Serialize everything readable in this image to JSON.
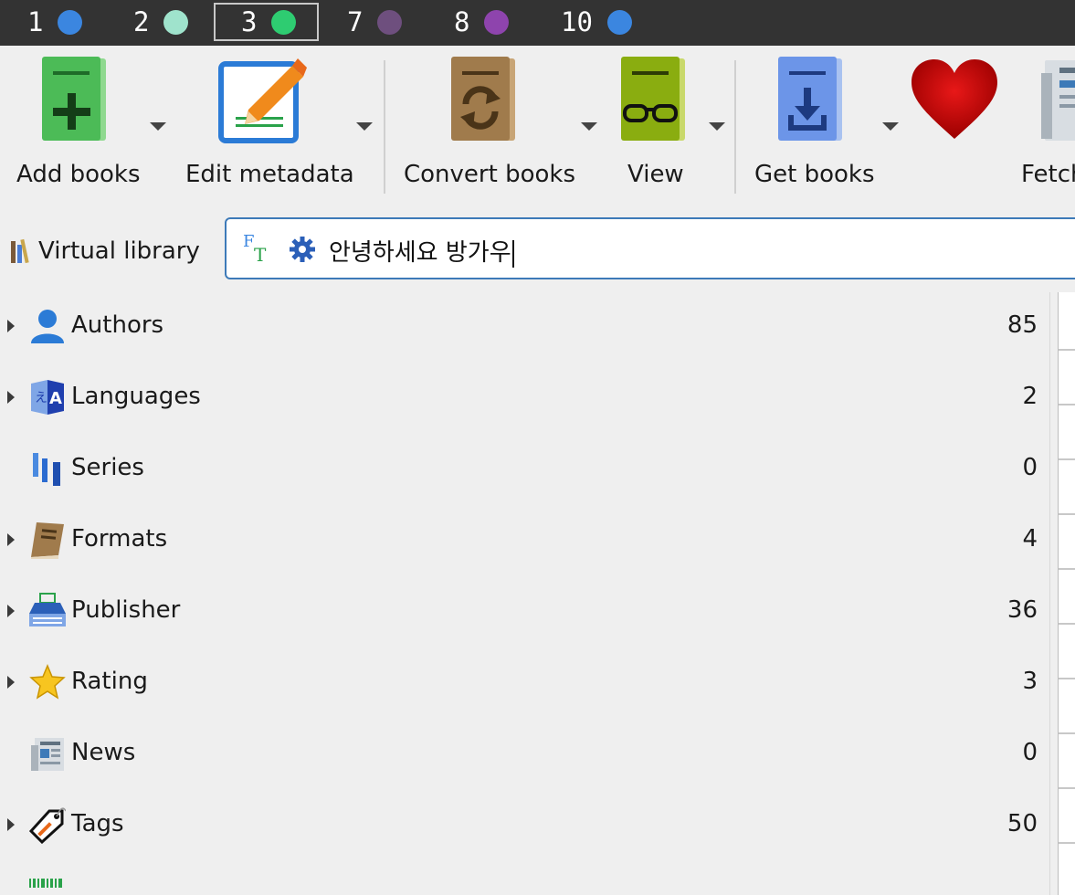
{
  "workspaces": [
    {
      "num": "1",
      "color": "#3b86e0",
      "active": false
    },
    {
      "num": "2",
      "color": "#9fe3cc",
      "active": false
    },
    {
      "num": "3",
      "color": "#2ecc71",
      "active": true
    },
    {
      "num": "7",
      "color": "#6e4f7e",
      "active": false
    },
    {
      "num": "8",
      "color": "#8e44ad",
      "active": false
    },
    {
      "num": "10",
      "color": "#3b86e0",
      "active": false
    }
  ],
  "toolbar": {
    "add_books": "Add books",
    "edit_metadata": "Edit metadata",
    "convert_books": "Convert books",
    "view": "View",
    "get_books": "Get books",
    "fetch_news": "Fetch"
  },
  "search": {
    "virtual_library": "Virtual library",
    "query": "안녕하세요 방가우"
  },
  "tag_browser": [
    {
      "label": "Authors",
      "count": "85",
      "icon": "authors-icon",
      "expandable": true
    },
    {
      "label": "Languages",
      "count": "2",
      "icon": "languages-icon",
      "expandable": true
    },
    {
      "label": "Series",
      "count": "0",
      "icon": "series-icon",
      "expandable": false
    },
    {
      "label": "Formats",
      "count": "4",
      "icon": "formats-icon",
      "expandable": true
    },
    {
      "label": "Publisher",
      "count": "36",
      "icon": "publisher-icon",
      "expandable": true
    },
    {
      "label": "Rating",
      "count": "3",
      "icon": "rating-icon",
      "expandable": true
    },
    {
      "label": "News",
      "count": "0",
      "icon": "news-icon",
      "expandable": false
    },
    {
      "label": "Tags",
      "count": "50",
      "icon": "tags-icon",
      "expandable": true
    }
  ],
  "colors": {
    "workspace_bar": "#333333",
    "search_border": "#3d7ab8",
    "background": "#efefef"
  }
}
